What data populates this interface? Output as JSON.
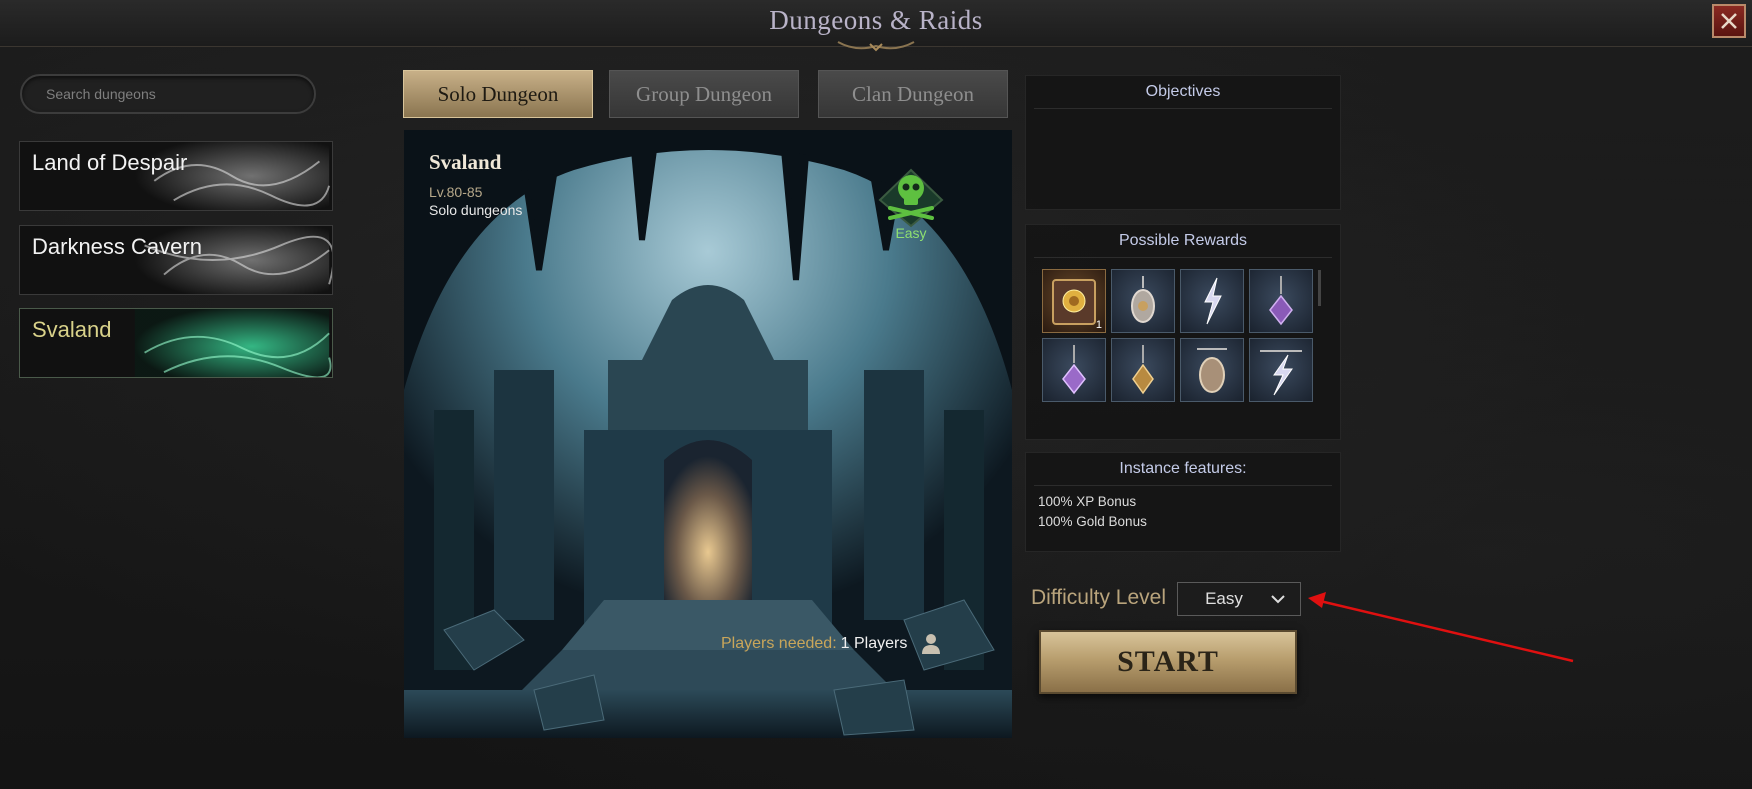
{
  "window": {
    "title": "Dungeons & Raids"
  },
  "search": {
    "placeholder": "Search dungeons"
  },
  "dungeon_list": [
    {
      "label": "Land of Despair",
      "active": false
    },
    {
      "label": "Darkness Cavern",
      "active": false
    },
    {
      "label": "Svaland",
      "active": true
    }
  ],
  "tabs": [
    {
      "label": "Solo Dungeon",
      "active": true
    },
    {
      "label": "Group Dungeon",
      "active": false
    },
    {
      "label": "Clan Dungeon",
      "active": false
    }
  ],
  "dungeon": {
    "name": "Svaland",
    "level": "Lv.80-85",
    "type": "Solo dungeons",
    "difficulty_badge": "Easy",
    "players_key": "Players needed:",
    "players_value": "1 Players"
  },
  "objectives": {
    "title": "Objectives"
  },
  "rewards": {
    "title": "Possible Rewards",
    "items": [
      {
        "icon": "spellbook-icon",
        "count": "1"
      },
      {
        "icon": "amulet-icon",
        "count": ""
      },
      {
        "icon": "lightning-pendant-icon",
        "count": ""
      },
      {
        "icon": "purple-gem-pendant-icon",
        "count": ""
      },
      {
        "icon": "purple-gem-pendant-icon",
        "count": ""
      },
      {
        "icon": "gold-gem-pendant-icon",
        "count": ""
      },
      {
        "icon": "amulet-icon",
        "count": ""
      },
      {
        "icon": "lightning-pendant-icon",
        "count": ""
      }
    ]
  },
  "features": {
    "title": "Instance features:",
    "lines": [
      "100% XP Bonus",
      "100% Gold Bonus"
    ]
  },
  "difficulty": {
    "label": "Difficulty Level",
    "selected": "Easy"
  },
  "start": {
    "label": "START"
  },
  "colors": {
    "accent_gold": "#c8b088",
    "annotation_arrow": "#e01010",
    "easy_green": "#8fe070"
  }
}
